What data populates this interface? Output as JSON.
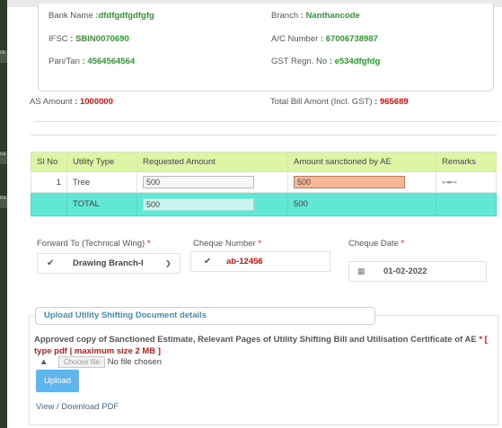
{
  "left_strip": {
    "tabs": [
      "ck",
      "ca",
      "lra"
    ]
  },
  "bank": {
    "bank_name_label": "Bank Name",
    "bank_name": ":dfdfgdfgdfgfg",
    "branch_label": "Branch",
    "branch": ": Nanthancode",
    "ifsc_label": "IFSC",
    "ifsc": ": SBIN0070690",
    "ac_label": "A/C Number",
    "ac": ": 67006738987",
    "pan_label": "Pan/Tan",
    "pan": ": 4564564564",
    "gst_label": "GST Regn. No",
    "gst": ": e534dfgfdg"
  },
  "amounts": {
    "as_label": "AS Amount",
    "as_value": ": 1000000",
    "bill_label": "Total Bill Amont (Incl. GST)",
    "bill_value": ": 965689"
  },
  "table": {
    "headers": [
      "Sl No",
      "Utility Type",
      "Requested Amount",
      "Amount sanctioned by AE",
      "Remarks"
    ],
    "row": {
      "sl": "1",
      "type": "Tree",
      "requested": "500",
      "sanctioned": "500"
    },
    "total": {
      "label": "TOTAL",
      "requested": "500",
      "sanctioned": "500"
    }
  },
  "form": {
    "forward_label": "Forward To (Technical Wing)",
    "forward_value": "Drawing Branch-I",
    "cheque_number_label": "Cheque Number",
    "cheque_number_value": "ab-12456",
    "cheque_date_label": "Cheque Date",
    "cheque_date_value": "01-02-2022",
    "required_mark": "*"
  },
  "upload": {
    "legend": "Upload Utility Shifting Document details",
    "text": "Approved copy of Sanctioned Estimate, Relevant Pages of Utility Shifting Bill and Utilisation Certificate of AE",
    "requirement": "* [ type pdf | maximum size 2 MB ]",
    "choose_file": "Choose file",
    "no_file": "No file chosen",
    "upload_button": "Upload",
    "view_link": "View / Download PDF"
  },
  "colors": {
    "green_value": "#2d9a2d",
    "red_value": "#dd1111",
    "header_bg": "#dff5a6",
    "total_bg": "#62e7d4",
    "sanctioned_bg": "#f8b896",
    "upload_btn": "#5fb6ee"
  }
}
